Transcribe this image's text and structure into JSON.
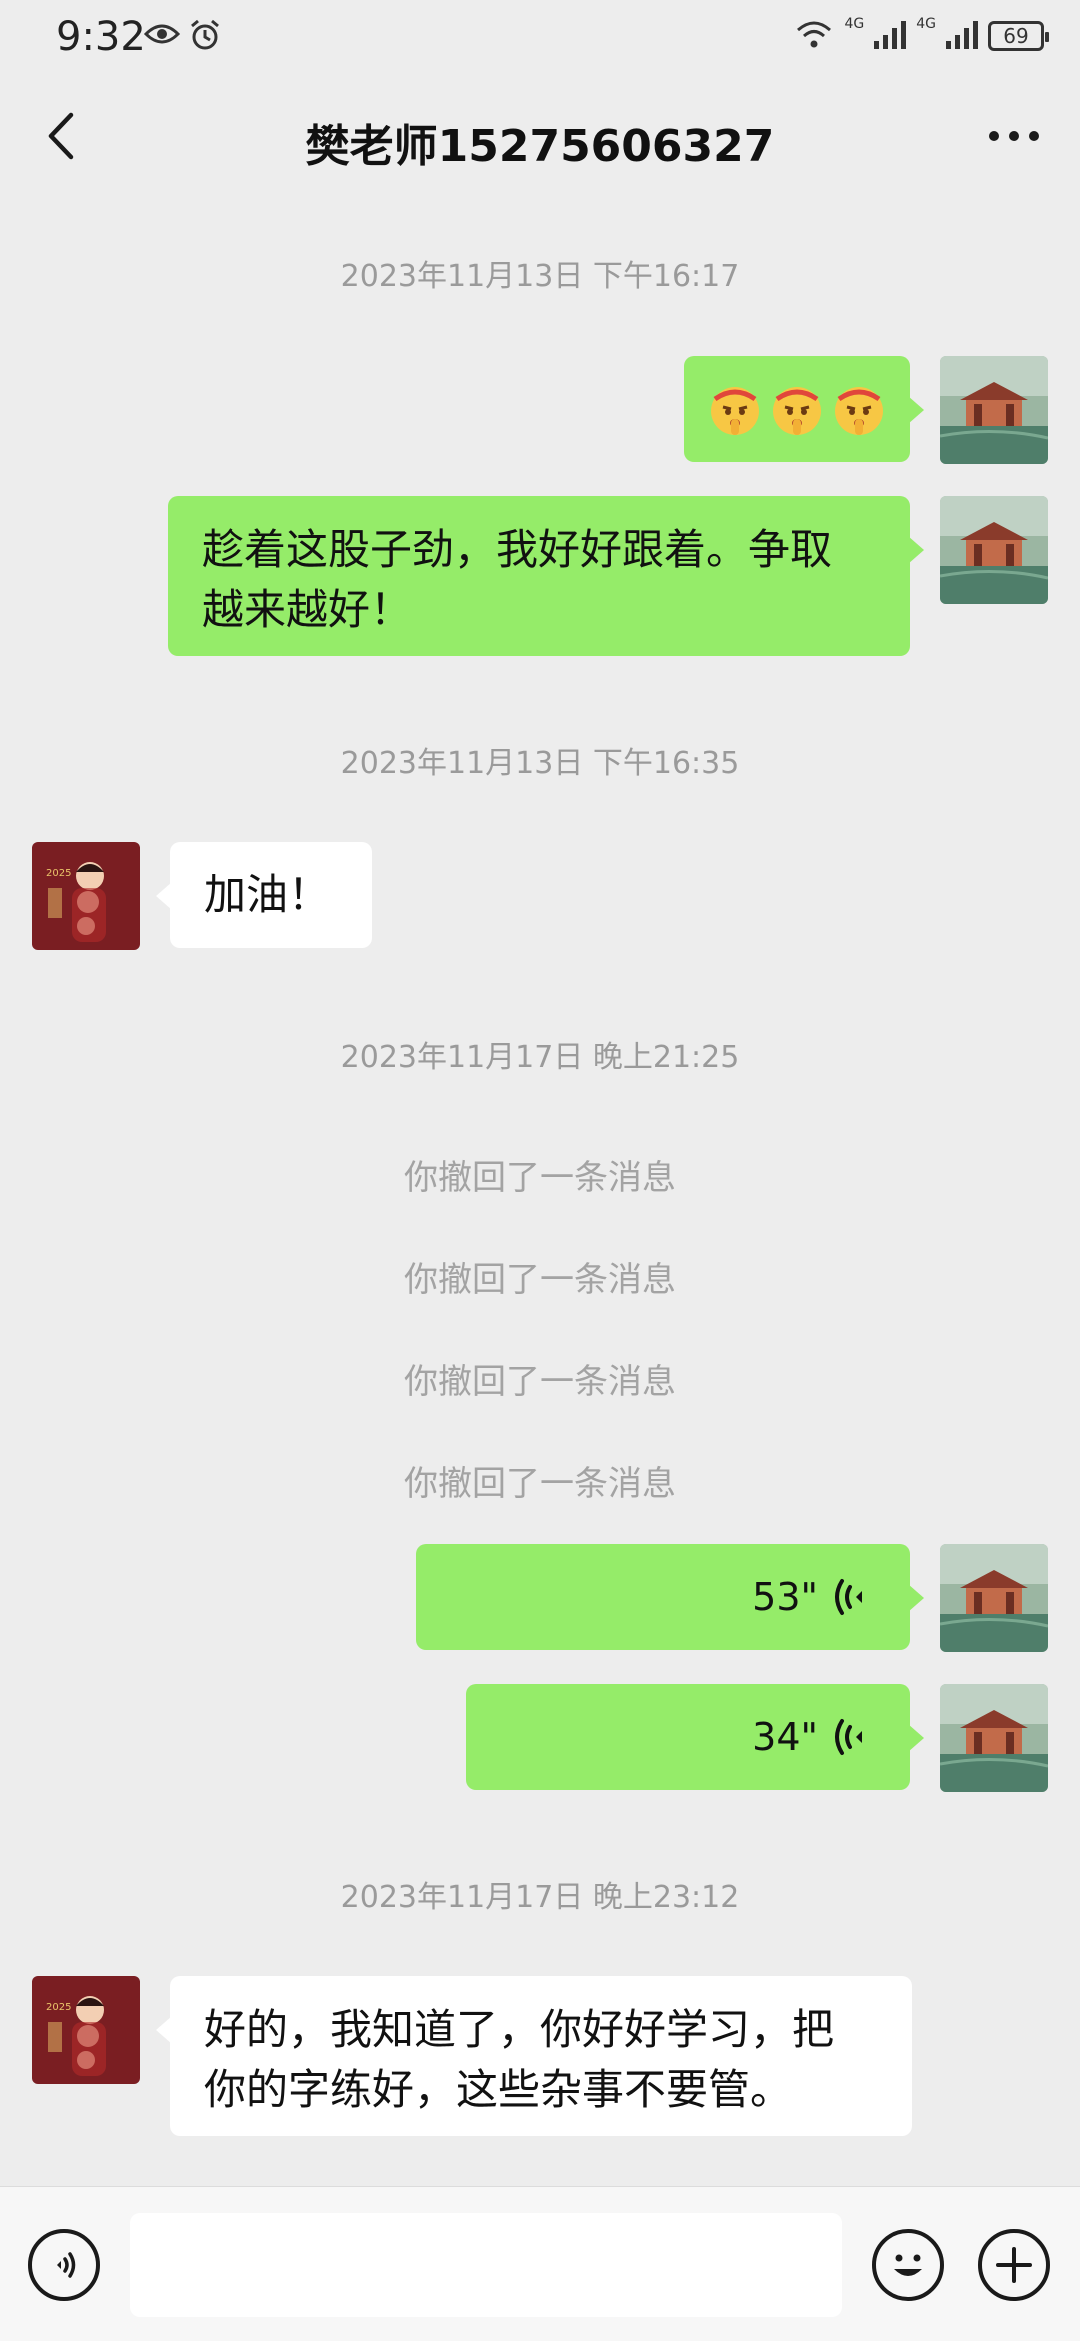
{
  "status_bar": {
    "time": "9:32",
    "network_labels": [
      "4G",
      "4G"
    ],
    "battery": "69"
  },
  "header": {
    "title": "樊老师15275606327"
  },
  "messages": {
    "ts1": "2023年11月13日 下午16:17",
    "m1_emojis": [
      "emoji-shush-face",
      "emoji-shush-face",
      "emoji-shush-face"
    ],
    "m2_text_line1": "趁着这股子劲，我好好跟着。争取",
    "m2_text_line2": "越来越好！",
    "ts2": "2023年11月13日 下午16:35",
    "m3_text": "加油！",
    "ts3": "2023年11月17日 晚上21:25",
    "recalled": [
      "你撤回了一条消息",
      "你撤回了一条消息",
      "你撤回了一条消息",
      "你撤回了一条消息"
    ],
    "voice1_duration": "53\"",
    "voice2_duration": "34\"",
    "ts4": "2023年11月17日 晚上23:12",
    "m6_text_line1": "好的，我知道了，你好好学习，把",
    "m6_text_line2": "你的字练好，这些杂事不要管。"
  },
  "input_bar": {
    "placeholder": ""
  },
  "colors": {
    "background": "#ededed",
    "outgoing_bubble": "#95ec69",
    "incoming_bubble": "#ffffff",
    "timestamp": "#9a9a9a"
  }
}
